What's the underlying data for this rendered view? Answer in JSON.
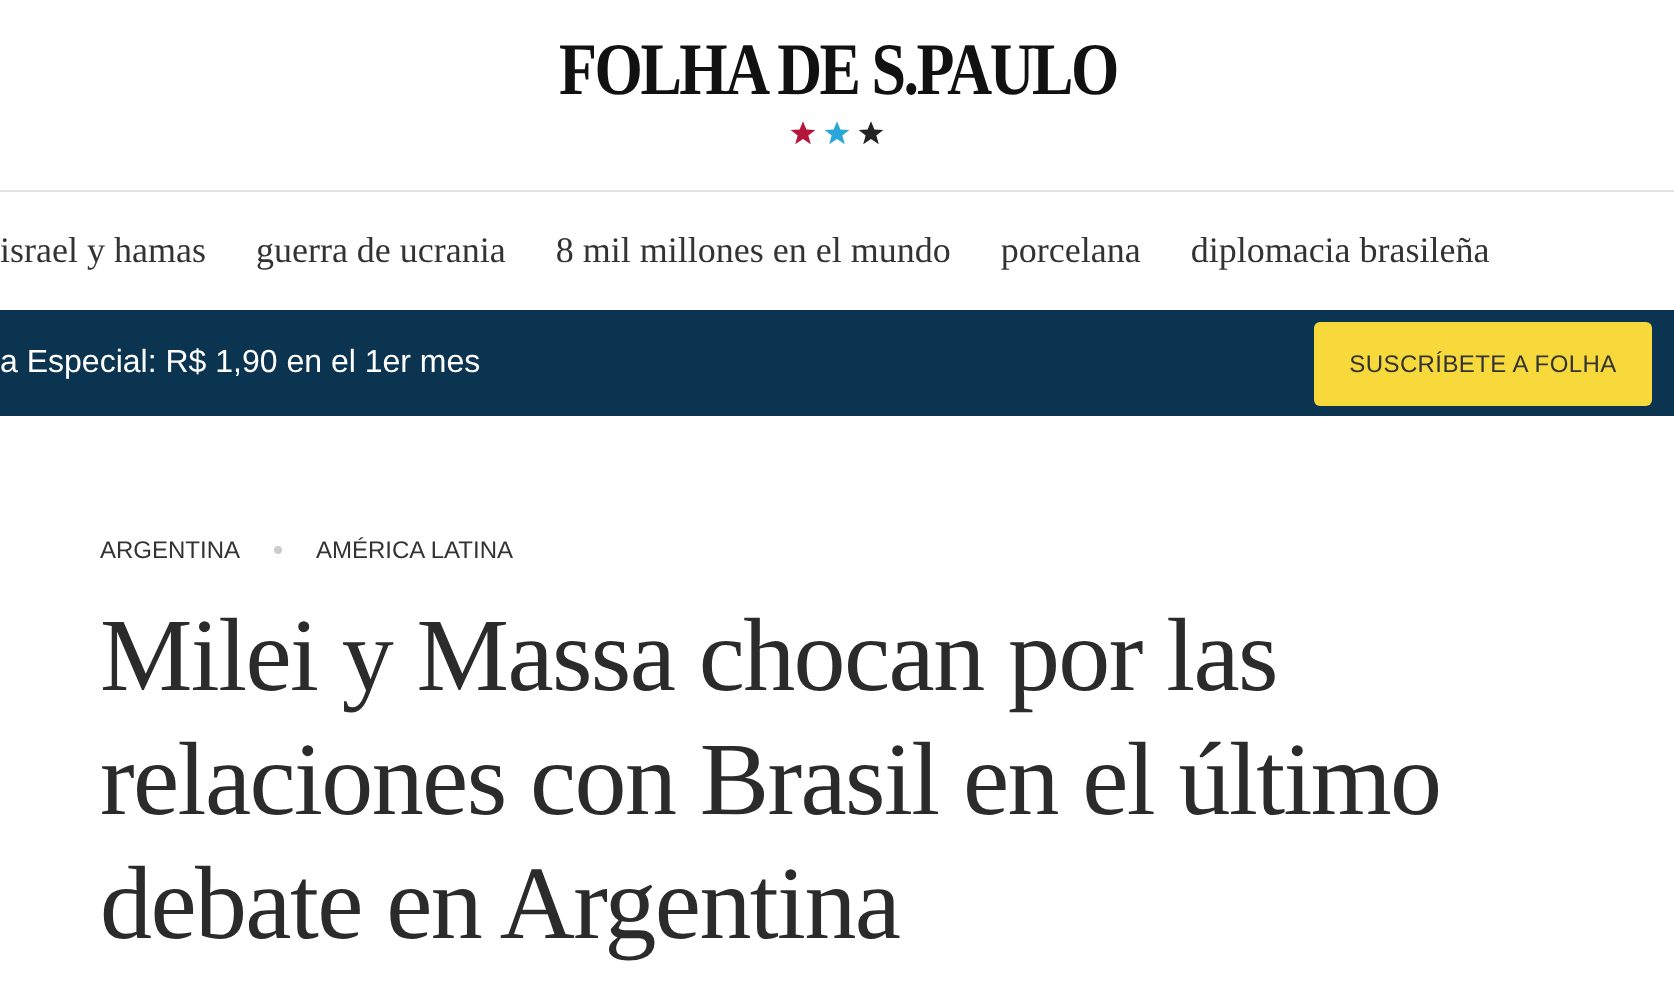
{
  "header": {
    "logo": "FOLHA DE S.PAULO",
    "stars": [
      {
        "color": "#b3163a"
      },
      {
        "color": "#2aa7d8"
      },
      {
        "color": "#222222"
      }
    ]
  },
  "nav": {
    "items": [
      "israel y hamas",
      "guerra de ucrania",
      "8 mil millones en el mundo",
      "porcelana",
      "diplomacia brasileña"
    ]
  },
  "banner": {
    "text": "a Especial: R$ 1,90 en el 1er mes",
    "button": "SUSCRÍBETE A FOLHA"
  },
  "article": {
    "tags": [
      "ARGENTINA",
      "AMÉRICA LATINA"
    ],
    "headline": "Milei y Massa chocan por las relaciones con Brasil en el último debate en Argentina"
  }
}
